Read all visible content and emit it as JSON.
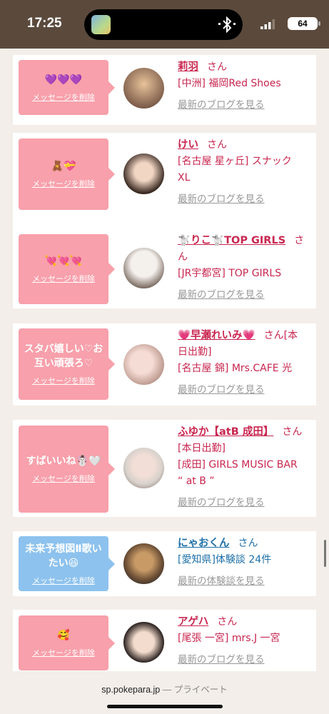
{
  "status_bar": {
    "time": "17:25",
    "battery": "64"
  },
  "cards": [
    {
      "message": "💜💜💜",
      "delete_label": "メッセージを削除",
      "bubble_color": "pink",
      "name": "莉羽",
      "honorific": "さん",
      "shop_lines": [
        "[中洲] 福岡Red Shoes"
      ],
      "link": "最新のブログを見る"
    },
    {
      "message": "🧸💝",
      "delete_label": "メッセージを削除",
      "bubble_color": "pink",
      "name": "けい",
      "honorific": "さん",
      "shop_lines": [
        "[名古屋 星ヶ丘] スナック",
        "XL"
      ],
      "link": "最新のブログを見る"
    },
    {
      "message": "💘💘💘",
      "delete_label": "メッセージを削除",
      "bubble_color": "pink",
      "name": "🐩りこ🐩TOP GIRLS",
      "honorific": "さん",
      "shop_lines": [
        "[JR宇都宮] TOP GIRLS"
      ],
      "link": "最新のブログを見る"
    },
    {
      "message": "スタバ嬉しい♡お互い頑張ろ♡",
      "delete_label": "メッセージを削除",
      "bubble_color": "pink",
      "name": "💗早瀬れいみ💗",
      "honorific": "さん[本",
      "shop_lines": [
        "日出勤]",
        "[名古屋 錦] Mrs.CAFE 光"
      ],
      "link": "最新のブログを見る"
    },
    {
      "message": "すばいいね☃️🤍",
      "delete_label": "メッセージを削除",
      "bubble_color": "pink",
      "name": "ふゆか【atB 成田】",
      "honorific": "さん",
      "shop_lines": [
        "[本日出勤]",
        "[成田] GIRLS MUSIC BAR",
        "“ at B ”"
      ],
      "link": "最新のブログを見る"
    },
    {
      "message": "未来予想図Ⅱ歌いたい😆",
      "delete_label": "メッセージを削除",
      "bubble_color": "blue",
      "name": "にゃおくん",
      "honorific": "さん",
      "shop_lines": [
        "[愛知県]体験談 24件"
      ],
      "link": "最新の体験談を見る"
    },
    {
      "message": "🥰",
      "delete_label": "メッセージを削除",
      "bubble_color": "pink",
      "name": "アゲハ",
      "honorific": "さん",
      "shop_lines": [
        "[尾張 一宮] mrs.J 一宮"
      ],
      "link": "最新のブログを見る"
    }
  ],
  "browser": {
    "domain": "sp.pokepara.jp",
    "private_label": "— プライベート"
  },
  "colors": {
    "pink": "#f8a0ab",
    "blue": "#8dc2ee",
    "name_pink": "#c8264f",
    "name_blue": "#1d6fa8",
    "status_bar": "#5b4a3c"
  }
}
